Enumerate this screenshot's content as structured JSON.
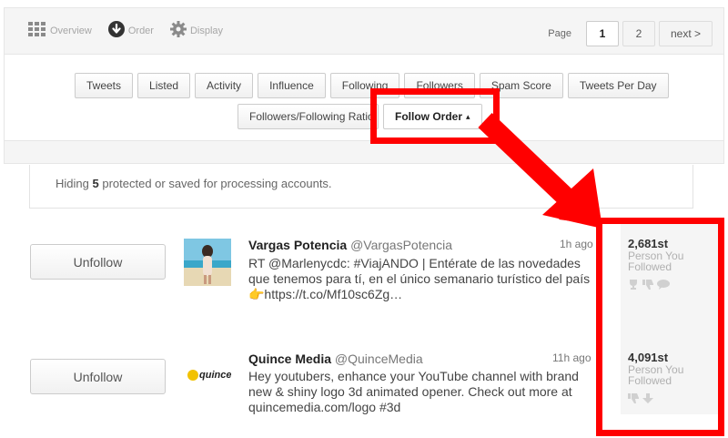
{
  "nav": {
    "overview": "Overview",
    "order": "Order",
    "display": "Display"
  },
  "pager": {
    "label": "Page",
    "pages": [
      "1",
      "2"
    ],
    "next": "next >"
  },
  "sort": {
    "row1": [
      "Tweets",
      "Listed",
      "Activity",
      "Influence",
      "Following",
      "Followers",
      "Spam Score",
      "Tweets Per Day"
    ],
    "row2": [
      "Followers/Following Ratio"
    ],
    "selected": "Follow Order",
    "selected_caret": "▴"
  },
  "hiding": {
    "prefix": "Hiding",
    "count": "5",
    "suffix": "protected or saved for processing accounts."
  },
  "rows": [
    {
      "button": "Unfollow",
      "name": "Vargas Potencia",
      "handle": "@VargasPotencia",
      "time": "1h ago",
      "tweet": "RT @Marlenycdc: #ViajANDO | Entérate de las novedades que tenemos para tí, en el único semanario turístico del país 👉https://t.co/Mf10sc6Zg…",
      "order": "2,681st",
      "order_label": "Person You Followed"
    },
    {
      "button": "Unfollow",
      "name": "Quince Media",
      "handle": "@QuinceMedia",
      "time": "11h ago",
      "tweet": "Hey youtubers, enhance your YouTube channel with brand new & shiny logo 3d animated opener. Check out more at quincemedia.com/logo #3d",
      "order": "4,091st",
      "order_label": "Person You Followed",
      "avatar_text": "quince"
    }
  ],
  "colors": {
    "highlight": "#ff0000",
    "panel_bg": "#f5f5f5"
  }
}
